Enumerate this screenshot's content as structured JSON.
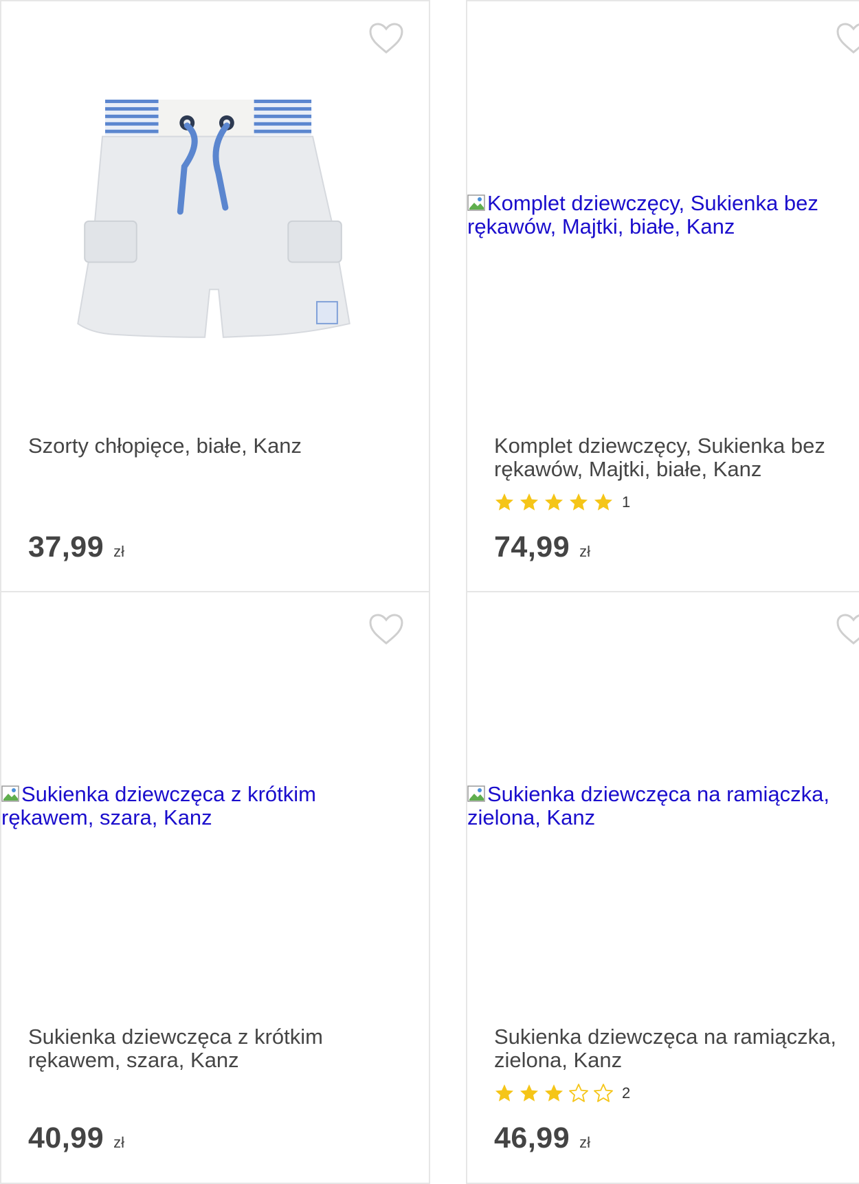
{
  "products": [
    {
      "title": "Szorty chłopięce, białe, Kanz",
      "image_alt": "",
      "price": "37,99",
      "currency": "zł",
      "rating_count": ""
    },
    {
      "title": "Komplet dziewczęcy, Sukienka bez rękawów, Majtki, białe, Kanz",
      "image_alt": "Komplet dziewczęcy, Sukienka bez rękawów, Majtki, białe, Kanz",
      "price": "74,99",
      "currency": "zł",
      "rating": 5,
      "rating_max": 5,
      "rating_count": "1"
    },
    {
      "title": "Sukienka dziewczęca z krótkim rękawem, szara, Kanz",
      "image_alt": "Sukienka dziewczęca z krótkim rękawem, szara, Kanz",
      "price": "40,99",
      "currency": "zł",
      "rating_count": ""
    },
    {
      "title": "Sukienka dziewczęca na ramiączka, zielona, Kanz",
      "image_alt": "Sukienka dziewczęca na ramiączka, zielona, Kanz",
      "price": "46,99",
      "currency": "zł",
      "rating": 3,
      "rating_max": 5,
      "rating_count": "2"
    }
  ],
  "icons": {
    "favorite": "heart-outline-icon",
    "rating_full": "star-filled-icon",
    "rating_empty": "star-outline-icon",
    "broken_image": "broken-image-icon"
  },
  "colors": {
    "star": "#f5c518",
    "link": "#1a0dcc",
    "text": "#454545",
    "border": "#e6e6e6"
  }
}
